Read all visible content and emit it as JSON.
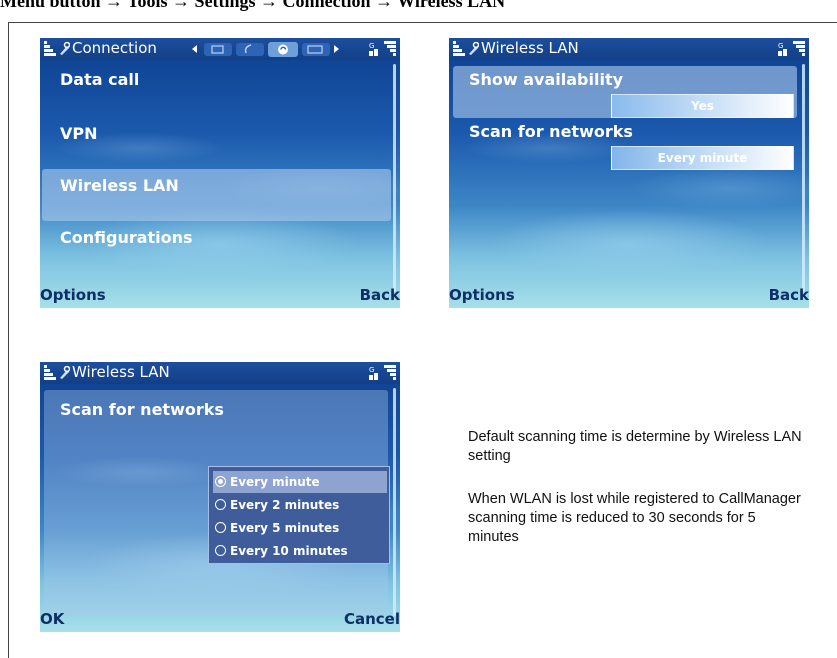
{
  "heading": "Menu button → Tools → Settings → Connection → Wireless LAN",
  "screen1": {
    "title": "Connection",
    "items": [
      "Data call",
      "VPN",
      "Wireless LAN",
      "Configurations"
    ],
    "selected_index": 2,
    "left_softkey": "Options",
    "right_softkey": "Back"
  },
  "screen2": {
    "title": "Wireless LAN",
    "settings": [
      {
        "label": "Show availability",
        "value": "Yes"
      },
      {
        "label": "Scan for networks",
        "value": "Every minute"
      }
    ],
    "left_softkey": "Options",
    "right_softkey": "Back"
  },
  "screen3": {
    "title": "Wireless LAN",
    "label": "Scan for networks",
    "options": [
      "Every minute",
      "Every 2 minutes",
      "Every 5 minutes",
      "Every 10 minutes"
    ],
    "selected_index": 0,
    "left_softkey": "OK",
    "right_softkey": "Cancel"
  },
  "notes": [
    "Default scanning time is determine by Wireless LAN setting",
    "When WLAN is lost while registered to CallManager scanning time is reduced to 30 seconds for 5 minutes"
  ],
  "colors": {
    "titlebar": "#123f86",
    "softkey_text": "#0d2e66",
    "highlight": "#aac8eb",
    "popup": "#3e5d9a"
  }
}
